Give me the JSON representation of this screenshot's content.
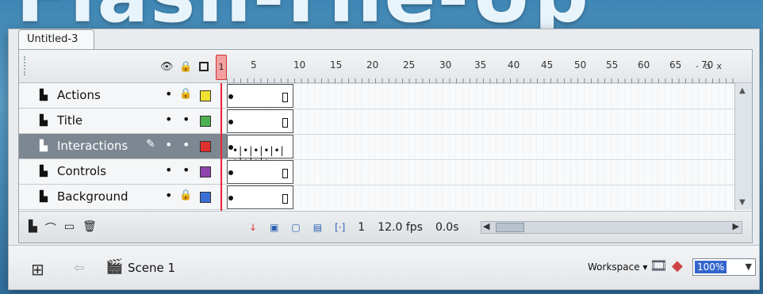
{
  "banner": {
    "text": "Flash-The-Up",
    "accent_color": "#f29a1e"
  },
  "document_tab": "Untitled-3",
  "timeline_header": {
    "playhead_frame": "1",
    "ruler_labels": [
      "5",
      "10",
      "15",
      "20",
      "25",
      "30",
      "35",
      "40",
      "45",
      "50",
      "55",
      "60",
      "65",
      "70"
    ],
    "icons": [
      "eye-icon",
      "lock-icon",
      "outline-icon"
    ],
    "window_controls": [
      "-",
      "▫",
      "x"
    ]
  },
  "layers": [
    {
      "name": "Actions",
      "color": "#f0e030",
      "locked": true,
      "selected": false
    },
    {
      "name": "Title",
      "color": "#4caf50",
      "locked": false,
      "selected": false
    },
    {
      "name": "Interactions",
      "color": "#e03030",
      "locked": false,
      "selected": true
    },
    {
      "name": "Controls",
      "color": "#8e44ad",
      "locked": false,
      "selected": false
    },
    {
      "name": "Background",
      "color": "#3b6fd6",
      "locked": true,
      "selected": false
    }
  ],
  "status": {
    "current_frame": "1",
    "frame_rate": "12.0 fps",
    "elapsed_time": "0.0s"
  },
  "edit_bar": {
    "scene_label": "Scene 1",
    "workspace_label": "Workspace ▾",
    "zoom_value": "100%"
  }
}
